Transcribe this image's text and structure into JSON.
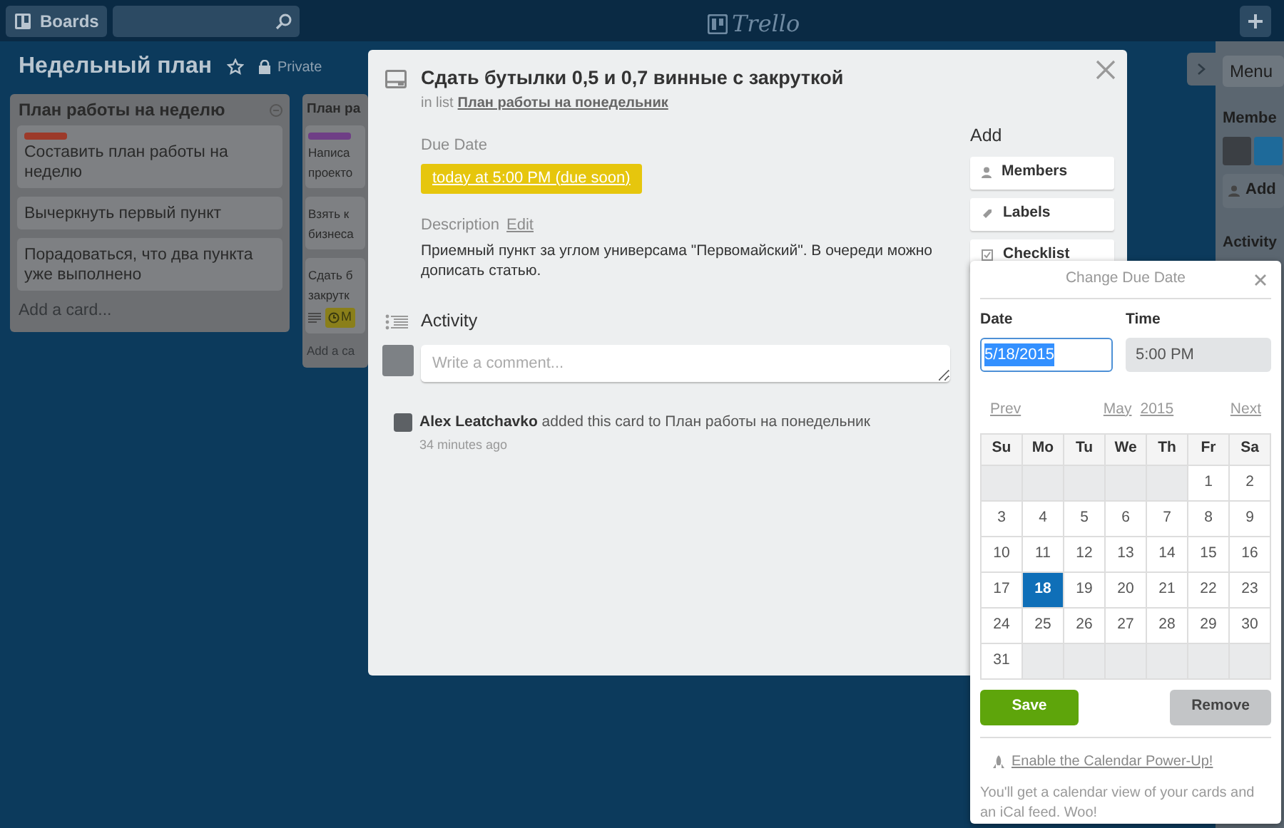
{
  "header": {
    "boards_button": "Boards",
    "logo": "Trello"
  },
  "board": {
    "title": "Недельный план",
    "visibility": "Private"
  },
  "lists": [
    {
      "title": "План работы на неделю",
      "cards": [
        {
          "color": "#9c3a2a",
          "text": "Составить план работы на неделю"
        },
        {
          "text": "Вычеркнуть первый пункт"
        },
        {
          "text": "Порадоваться, что два пункта уже выполнено"
        }
      ],
      "add_card": "Add a card..."
    },
    {
      "title": "План ра",
      "cards": [
        {
          "color": "#6f3e86",
          "text": "Написа проекто"
        },
        {
          "text": "Взять к бизнеса"
        },
        {
          "text": "Сдать б закрутк",
          "due_badge": "M"
        }
      ],
      "add_card": "Add a ca"
    }
  ],
  "sidebar": {
    "menu": "Menu",
    "members_heading": "Membe",
    "add_button": "Add",
    "activity_heading": "Activity"
  },
  "card_modal": {
    "title": "Сдать бутылки 0,5 и 0,7 винные с закруткой",
    "list_prefix": "in list",
    "list_link": "План работы на понедельник",
    "due_date": {
      "label": "Due Date",
      "value": "today at 5:00 PM (due soon)"
    },
    "description": {
      "label": "Description",
      "edit": "Edit",
      "text": "Приемный пункт за углом универсама \"Первомайский\". В очереди можно дописать статью."
    },
    "activity": {
      "heading": "Activity",
      "comment_placeholder": "Write a comment...",
      "entries": [
        {
          "author": "Alex Leatchavko",
          "action": "added this card to План работы на понедельник",
          "time": "34 minutes ago"
        }
      ]
    },
    "add": {
      "heading": "Add",
      "buttons": [
        {
          "kind": "members",
          "label": "Members"
        },
        {
          "kind": "labels",
          "label": "Labels"
        },
        {
          "kind": "checklist",
          "label": "Checklist"
        }
      ]
    }
  },
  "due_popover": {
    "title": "Change Due Date",
    "date": {
      "label": "Date",
      "value": "5/18/2015"
    },
    "time": {
      "label": "Time",
      "value": "5:00 PM"
    },
    "prev": "Prev",
    "month": "May",
    "year": "2015",
    "next": "Next",
    "weekdays": [
      "Su",
      "Mo",
      "Tu",
      "We",
      "Th",
      "Fr",
      "Sa"
    ],
    "days": [
      {
        "kind": "blank"
      },
      {
        "kind": "blank"
      },
      {
        "kind": "blank"
      },
      {
        "kind": "blank"
      },
      {
        "kind": "blank"
      },
      {
        "kind": "day",
        "day": "1",
        "selected": false
      },
      {
        "kind": "day",
        "day": "2",
        "selected": false
      },
      {
        "kind": "day",
        "day": "3",
        "selected": false
      },
      {
        "kind": "day",
        "day": "4",
        "selected": false
      },
      {
        "kind": "day",
        "day": "5",
        "selected": false
      },
      {
        "kind": "day",
        "day": "6",
        "selected": false
      },
      {
        "kind": "day",
        "day": "7",
        "selected": false
      },
      {
        "kind": "day",
        "day": "8",
        "selected": false
      },
      {
        "kind": "day",
        "day": "9",
        "selected": false
      },
      {
        "kind": "day",
        "day": "10",
        "selected": false
      },
      {
        "kind": "day",
        "day": "11",
        "selected": false
      },
      {
        "kind": "day",
        "day": "12",
        "selected": false
      },
      {
        "kind": "day",
        "day": "13",
        "selected": false
      },
      {
        "kind": "day",
        "day": "14",
        "selected": false
      },
      {
        "kind": "day",
        "day": "15",
        "selected": false
      },
      {
        "kind": "day",
        "day": "16",
        "selected": false
      },
      {
        "kind": "day",
        "day": "17",
        "selected": false
      },
      {
        "kind": "day",
        "day": "18",
        "selected": true
      },
      {
        "kind": "day",
        "day": "19",
        "selected": false
      },
      {
        "kind": "day",
        "day": "20",
        "selected": false
      },
      {
        "kind": "day",
        "day": "21",
        "selected": false
      },
      {
        "kind": "day",
        "day": "22",
        "selected": false
      },
      {
        "kind": "day",
        "day": "23",
        "selected": false
      },
      {
        "kind": "day",
        "day": "24",
        "selected": false
      },
      {
        "kind": "day",
        "day": "25",
        "selected": false
      },
      {
        "kind": "day",
        "day": "26",
        "selected": false
      },
      {
        "kind": "day",
        "day": "27",
        "selected": false
      },
      {
        "kind": "day",
        "day": "28",
        "selected": false
      },
      {
        "kind": "day",
        "day": "29",
        "selected": false
      },
      {
        "kind": "day",
        "day": "30",
        "selected": false
      },
      {
        "kind": "day",
        "day": "31",
        "selected": false
      },
      {
        "kind": "blank"
      },
      {
        "kind": "blank"
      },
      {
        "kind": "blank"
      },
      {
        "kind": "blank"
      },
      {
        "kind": "blank"
      },
      {
        "kind": "blank"
      }
    ],
    "save": "Save",
    "remove": "Remove",
    "powerup_link": "Enable the Calendar Power-Up!",
    "powerup_text": "You'll get a calendar view of your cards and an iCal feed. Woo!"
  }
}
